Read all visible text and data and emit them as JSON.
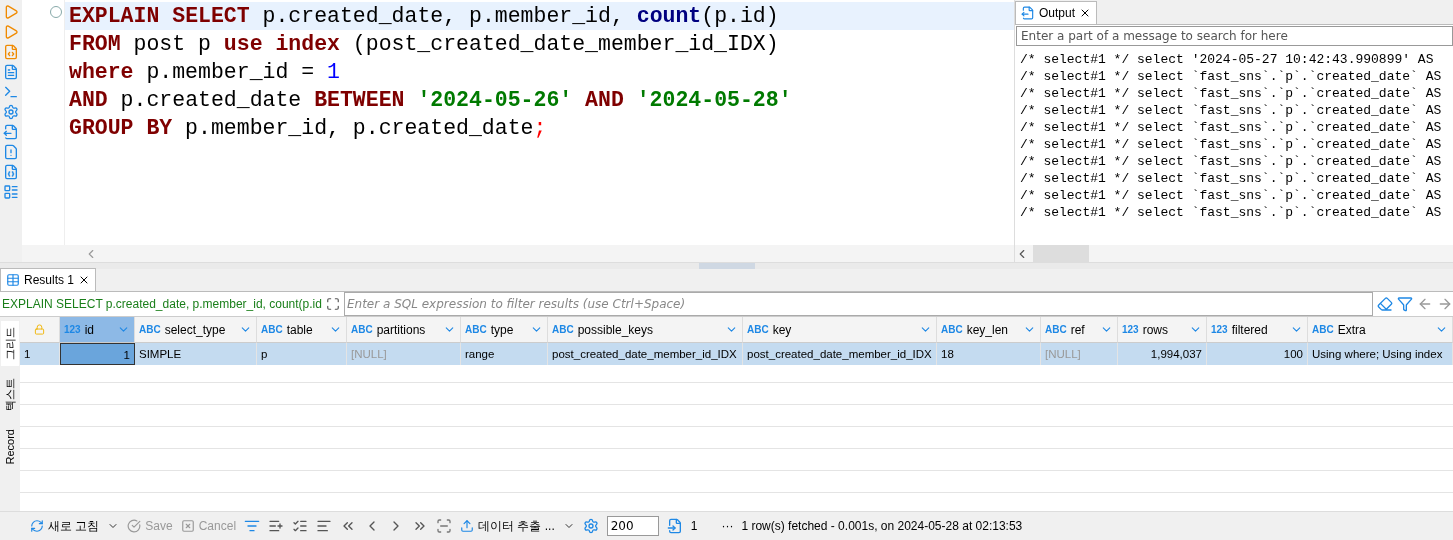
{
  "editor": {
    "lines": [
      {
        "tokens": [
          {
            "kind": "keyword",
            "text": "EXPLAIN"
          },
          {
            "kind": "keyword",
            "text": " SELECT"
          },
          {
            "kind": "ident",
            "text": " p.created_date, p.member_id, "
          },
          {
            "kind": "func",
            "text": "count"
          },
          {
            "kind": "ident",
            "text": "(p.id)"
          }
        ],
        "current": true
      },
      {
        "tokens": [
          {
            "kind": "keyword",
            "text": "FROM"
          },
          {
            "kind": "ident",
            "text": " post p "
          },
          {
            "kind": "keyword",
            "text": "use index"
          },
          {
            "kind": "ident",
            "text": " (post_created_date_member_id_IDX)"
          }
        ],
        "current": false
      },
      {
        "tokens": [
          {
            "kind": "keyword",
            "text": "where"
          },
          {
            "kind": "ident",
            "text": " p.member_id = "
          },
          {
            "kind": "number",
            "text": "1"
          }
        ],
        "current": false
      },
      {
        "tokens": [
          {
            "kind": "keyword",
            "text": "AND"
          },
          {
            "kind": "ident",
            "text": " p.created_date "
          },
          {
            "kind": "keyword",
            "text": "BETWEEN "
          },
          {
            "kind": "string",
            "text": "'2024-05-26'"
          },
          {
            "kind": "keyword",
            "text": " AND "
          },
          {
            "kind": "string",
            "text": "'2024-05-28'"
          }
        ],
        "current": false
      },
      {
        "tokens": [
          {
            "kind": "keyword",
            "text": "GROUP BY"
          },
          {
            "kind": "ident",
            "text": " p.member_id, p.created_date"
          },
          {
            "kind": "punct",
            "text": ";"
          }
        ],
        "current": false
      }
    ]
  },
  "output": {
    "tab": "Output",
    "search_placeholder": "Enter a part of a message to search for here",
    "lines": [
      "/* select#1 */ select '2024-05-27 10:42:43.990899' AS",
      "/* select#1 */ select `fast_sns`.`p`.`created_date` AS",
      "/* select#1 */ select `fast_sns`.`p`.`created_date` AS",
      "/* select#1 */ select `fast_sns`.`p`.`created_date` AS",
      "/* select#1 */ select `fast_sns`.`p`.`created_date` AS",
      "/* select#1 */ select `fast_sns`.`p`.`created_date` AS",
      "/* select#1 */ select `fast_sns`.`p`.`created_date` AS",
      "/* select#1 */ select `fast_sns`.`p`.`created_date` AS",
      "/* select#1 */ select `fast_sns`.`p`.`created_date` AS",
      "/* select#1 */ select `fast_sns`.`p`.`created_date` AS"
    ]
  },
  "results": {
    "tab": "Results 1",
    "query": "EXPLAIN SELECT p.created_date, p.member_id, count(p.id",
    "filter_placeholder": "Enter a SQL expression to filter results (use Ctrl+Space)",
    "side_tabs": [
      {
        "label": "그리드",
        "selected": true
      },
      {
        "label": "텍스트",
        "selected": false
      },
      {
        "label": "Record",
        "selected": false
      }
    ],
    "columns": [
      {
        "type_tag": "123",
        "label": "id",
        "kind": "number",
        "selected": true
      },
      {
        "type_tag": "ABC",
        "label": "select_type",
        "kind": "text",
        "selected": false
      },
      {
        "type_tag": "ABC",
        "label": "table",
        "kind": "text",
        "selected": false
      },
      {
        "type_tag": "ABC",
        "label": "partitions",
        "kind": "text",
        "selected": false
      },
      {
        "type_tag": "ABC",
        "label": "type",
        "kind": "text",
        "selected": false
      },
      {
        "type_tag": "ABC",
        "label": "possible_keys",
        "kind": "text",
        "selected": false
      },
      {
        "type_tag": "ABC",
        "label": "key",
        "kind": "text",
        "selected": false
      },
      {
        "type_tag": "ABC",
        "label": "key_len",
        "kind": "text",
        "selected": false
      },
      {
        "type_tag": "ABC",
        "label": "ref",
        "kind": "text",
        "selected": false
      },
      {
        "type_tag": "123",
        "label": "rows",
        "kind": "number",
        "selected": false
      },
      {
        "type_tag": "123",
        "label": "filtered",
        "kind": "number",
        "selected": false
      },
      {
        "type_tag": "ABC",
        "label": "Extra",
        "kind": "text",
        "selected": false
      }
    ],
    "rows": [
      {
        "number": "1",
        "selected": true,
        "cells": [
          {
            "value": "1",
            "null": false,
            "focused": true
          },
          {
            "value": "SIMPLE",
            "null": false,
            "focused": false
          },
          {
            "value": "p",
            "null": false,
            "focused": false
          },
          {
            "value": "[NULL]",
            "null": true,
            "focused": false
          },
          {
            "value": "range",
            "null": false,
            "focused": false
          },
          {
            "value": "post_created_date_member_id_IDX",
            "null": false,
            "focused": false
          },
          {
            "value": "post_created_date_member_id_IDX",
            "null": false,
            "focused": false
          },
          {
            "value": "18",
            "null": false,
            "focused": false
          },
          {
            "value": "[NULL]",
            "null": true,
            "focused": false
          },
          {
            "value": "1,994,037",
            "null": false,
            "focused": false
          },
          {
            "value": "100",
            "null": false,
            "focused": false
          },
          {
            "value": "Using where; Using index",
            "null": false,
            "focused": false
          }
        ]
      }
    ]
  },
  "toolbar": {
    "refresh": "새로 고침",
    "save": {
      "label": "Save",
      "disabled": true
    },
    "cancel": {
      "label": "Cancel",
      "disabled": true
    },
    "export": "데이터 추출 ...",
    "fetch_size": "200",
    "row_count": "1",
    "more": "···",
    "status": "1 row(s) fetched - 0.001s, on 2024-05-28 at 02:13:53"
  }
}
